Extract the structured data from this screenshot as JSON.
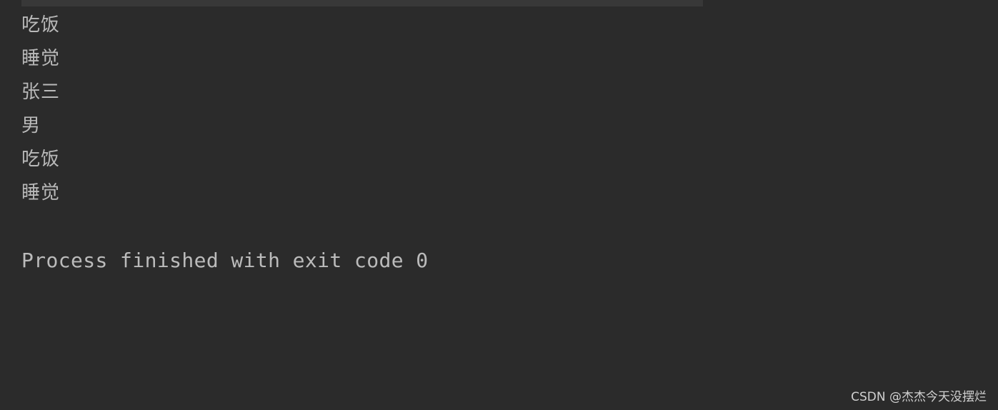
{
  "console": {
    "output_lines": [
      "吃饭",
      "睡觉",
      "张三",
      "男",
      "吃饭",
      "睡觉"
    ],
    "exit_message": "Process finished with exit code 0"
  },
  "watermark": {
    "text": "CSDN @杰杰今天没摆烂"
  },
  "colors": {
    "background": "#2b2b2b",
    "text": "#bbbbbb",
    "selected_line": "#383838"
  }
}
